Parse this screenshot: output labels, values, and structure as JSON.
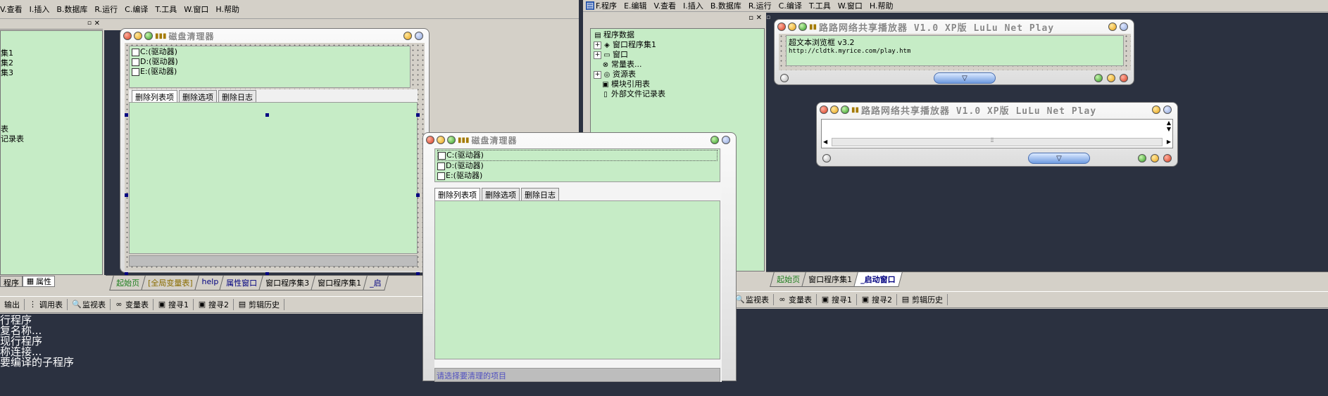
{
  "left_ide": {
    "menu": [
      "V.查看",
      "I.插入",
      "B.数据库",
      "R.运行",
      "C.编译",
      "T.工具",
      "W.窗口",
      "H.帮助"
    ],
    "tree_items": [
      "集1",
      "集2",
      "集3",
      "表",
      "记录表"
    ],
    "panel_tabs": [
      "程序",
      "属性"
    ],
    "bottom_tabs": [
      "起始页",
      "[全局变量表]",
      "help",
      "属性窗口",
      "窗口程序集3",
      "窗口程序集1",
      "_启"
    ],
    "toolbar": [
      "输出",
      "调用表",
      "监视表",
      "变量表",
      "搜寻1",
      "搜寻2",
      "剪辑历史"
    ],
    "console_lines": [
      "行程序",
      "复名称...",
      "现行程序",
      "称连接...",
      "要编译的子程序"
    ]
  },
  "design_window": {
    "title": "磁盘清理器",
    "drives": [
      "C:(驱动器)",
      "D:(驱动器)",
      "E:(驱动器)"
    ],
    "tabs": [
      "删除列表项",
      "删除选项",
      "删除日志"
    ]
  },
  "float_window": {
    "title": "磁盘清理器",
    "drives": [
      "C:(驱动器)",
      "D:(驱动器)",
      "E:(驱动器)"
    ],
    "tabs": [
      "删除列表项",
      "删除选项",
      "删除日志"
    ],
    "status": "请选择要清理的项目"
  },
  "right_ide": {
    "menu": [
      "F.程序",
      "E.编辑",
      "V.查看",
      "I.插入",
      "B.数据库",
      "R.运行",
      "C.编译",
      "T.工具",
      "W.窗口",
      "H.帮助"
    ],
    "tree": [
      {
        "label": "程序数据",
        "expand": "",
        "icon": "folder-icon",
        "glyph": "▤"
      },
      {
        "label": "窗口程序集1",
        "expand": "+",
        "icon": "module-icon",
        "glyph": "◈"
      },
      {
        "label": "窗口",
        "expand": "+",
        "icon": "window-icon",
        "glyph": "▭"
      },
      {
        "label": "常量表...",
        "expand": "",
        "icon": "constant-icon",
        "glyph": "⊗"
      },
      {
        "label": "资源表",
        "expand": "+",
        "icon": "resource-icon",
        "glyph": "◎"
      },
      {
        "label": "模块引用表",
        "expand": "",
        "icon": "module-ref-icon",
        "glyph": "▣"
      },
      {
        "label": "外部文件记录表",
        "expand": "",
        "icon": "file-icon",
        "glyph": "▯"
      }
    ],
    "bottom_tabs": [
      "起始页",
      "窗口程序集1",
      "_启动窗口"
    ],
    "toolbar": [
      "监视表",
      "变量表",
      "搜寻1",
      "搜寻2",
      "剪辑历史"
    ]
  },
  "player_design": {
    "title": "路路网络共享播放器 V1.0 XP版  LuLu Net Play",
    "browser_label": "超文本浏览框 v3.2",
    "url": "http://cldtk.myrice.com/play.htm"
  },
  "player_window": {
    "title": "路路网络共享播放器 V1.0 XP版  LuLu Net Play"
  }
}
